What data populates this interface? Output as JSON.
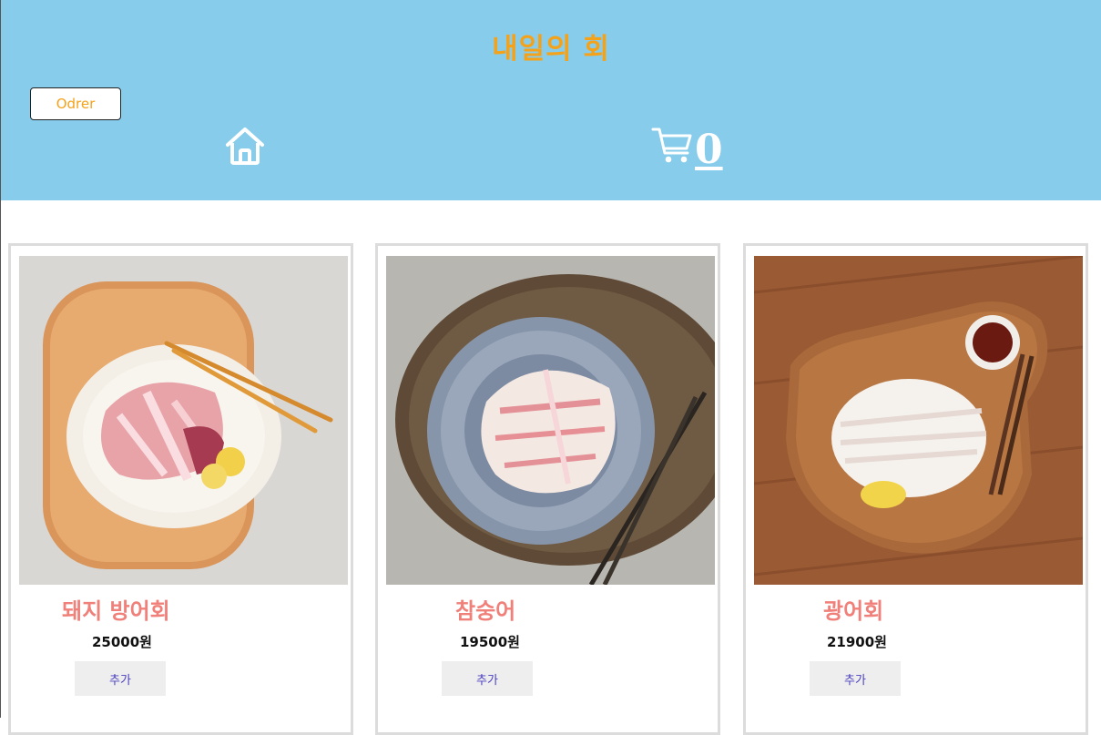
{
  "header": {
    "title": "내일의 회",
    "order_button": "Odrer",
    "home_icon": "home-icon",
    "cart_icon": "cart-icon",
    "cart_count": "0"
  },
  "products": [
    {
      "name": "돼지 방어회",
      "price": "25000원",
      "add_label": "추가"
    },
    {
      "name": "참숭어",
      "price": "19500원",
      "add_label": "추가"
    },
    {
      "name": "광어회",
      "price": "21900원",
      "add_label": "추가"
    }
  ],
  "colors": {
    "header_bg": "#87cceb",
    "title": "#f5a21b",
    "product_name": "#f0807a",
    "add_button_text": "#4a3fbf"
  }
}
